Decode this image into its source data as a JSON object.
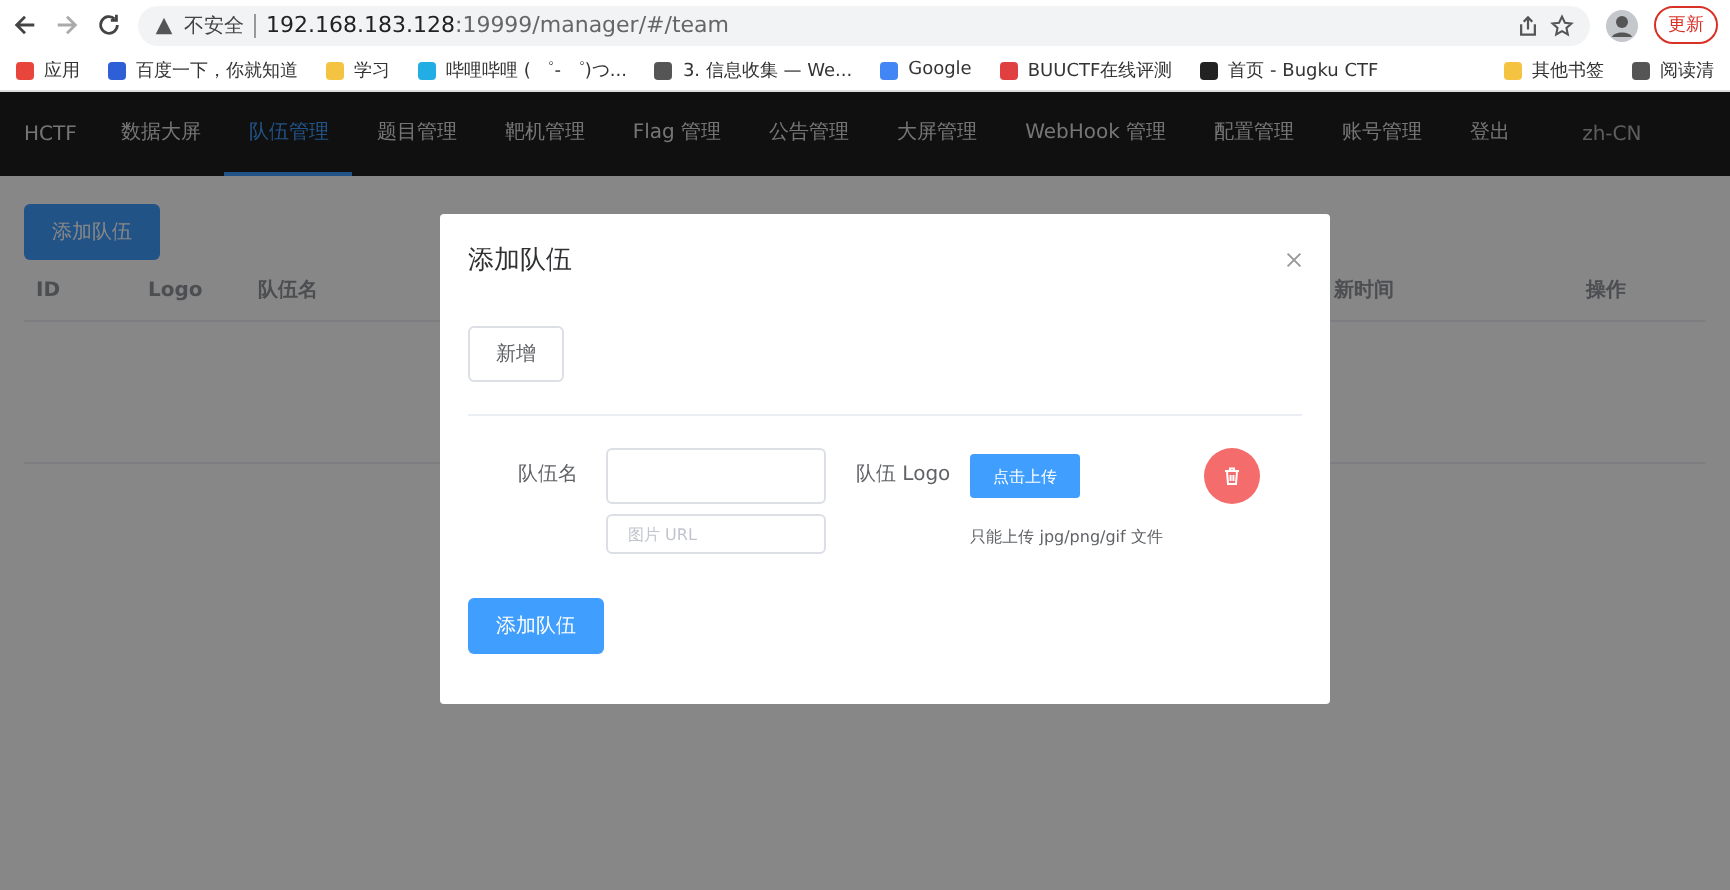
{
  "browser": {
    "security": "不安全",
    "url_host": "192.168.183.128",
    "url_rest": ":19999/manager/#/team",
    "update_button": "更新"
  },
  "bookmarks": [
    {
      "label": "应用",
      "color": "#e8453c"
    },
    {
      "label": "百度一下，你就知道",
      "color": "#2f5fd6"
    },
    {
      "label": "学习",
      "color": "#f5c342"
    },
    {
      "label": "哔哩哔哩 ( ゜- ゜)つ...",
      "color": "#23ade5"
    },
    {
      "label": "3. 信息收集 — We...",
      "color": "#555555"
    },
    {
      "label": "Google",
      "color": "#4285f4"
    },
    {
      "label": "BUUCTF在线评测",
      "color": "#e04040"
    },
    {
      "label": "首页 - Bugku CTF",
      "color": "#222222"
    }
  ],
  "bookmarks_right": [
    {
      "label": "其他书签",
      "color": "#f5c342"
    },
    {
      "label": "阅读清",
      "color": "#555555"
    }
  ],
  "nav": {
    "brand": "HCTF",
    "items": [
      {
        "label": "数据大屏",
        "selected": false
      },
      {
        "label": "队伍管理",
        "selected": true
      },
      {
        "label": "题目管理",
        "selected": false
      },
      {
        "label": "靶机管理",
        "selected": false
      },
      {
        "label": "Flag 管理",
        "selected": false
      },
      {
        "label": "公告管理",
        "selected": false
      },
      {
        "label": "大屏管理",
        "selected": false
      },
      {
        "label": "WebHook 管理",
        "selected": false
      },
      {
        "label": "配置管理",
        "selected": false
      },
      {
        "label": "账号管理",
        "selected": false
      },
      {
        "label": "登出",
        "selected": false
      }
    ],
    "locale": "zh-CN"
  },
  "page": {
    "add_button": "添加队伍",
    "columns": [
      "ID",
      "Logo",
      "队伍名",
      "新时间",
      "操作"
    ]
  },
  "dialog": {
    "title": "添加队伍",
    "new_button": "新增",
    "name_label": "队伍名",
    "url_placeholder": "图片 URL",
    "logo_label": "队伍 Logo",
    "upload_button": "点击上传",
    "upload_tip": "只能上传 jpg/png/gif 文件",
    "submit_button": "添加队伍"
  }
}
